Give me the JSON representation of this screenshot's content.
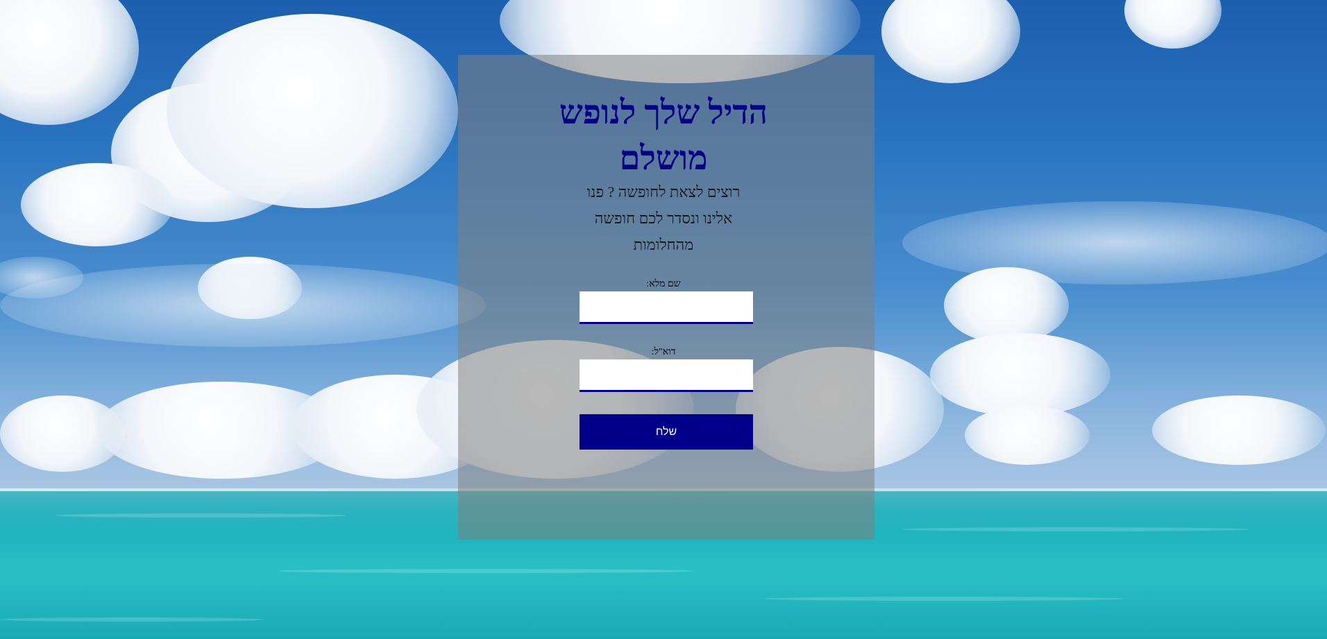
{
  "title": "הדיל שלך לנופש מושלם",
  "subtitle": "רוצים לצאת לחופשה ? פנו אלינו ונסדר לכם חופשה מהחלומות",
  "form": {
    "name_label": "שם מלא:",
    "name_value": "",
    "email_label": "דוא\"ל:",
    "email_value": "",
    "submit_label": "שלח"
  },
  "colors": {
    "accent": "#00008b",
    "panel_overlay": "rgba(128,128,128,0.55)",
    "sky": "#2b74c0",
    "sea": "#1fb4bd"
  }
}
